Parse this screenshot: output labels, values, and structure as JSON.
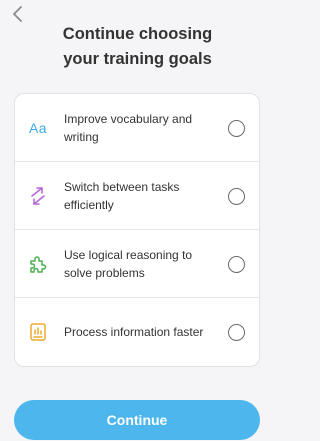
{
  "header": {
    "title_line1": "Continue choosing",
    "title_line2": "your training goals"
  },
  "goals": [
    {
      "label": "Improve vocabulary and writing",
      "icon": "Aa",
      "icon_name": "text-aa-icon",
      "color": "#3fa9e6",
      "selected": false
    },
    {
      "label": "Switch between tasks efficiently",
      "icon_name": "switch-arrows-icon",
      "color": "#b464d8",
      "selected": false
    },
    {
      "label": "Use logical reasoning to solve problems",
      "icon_name": "puzzle-piece-icon",
      "color": "#4caf50",
      "selected": false
    },
    {
      "label": "Process information faster",
      "icon_name": "chart-card-icon",
      "color": "#f0a830",
      "selected": false
    }
  ],
  "continue_label": "Continue",
  "colors": {
    "accent": "#4db6ec",
    "background": "#f5f5f7"
  }
}
